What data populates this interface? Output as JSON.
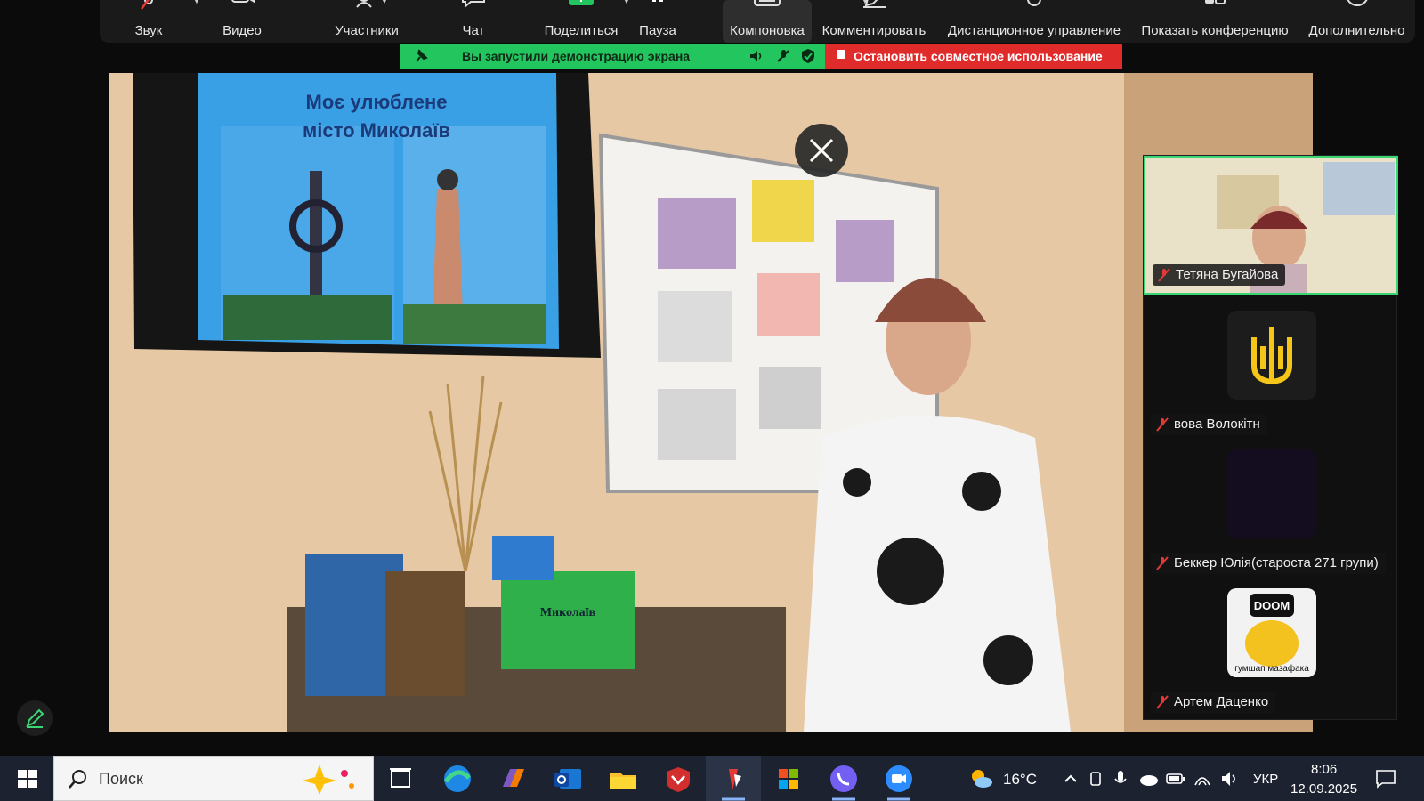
{
  "toolbar": {
    "items": [
      {
        "label": "Звук"
      },
      {
        "label": "Видео"
      },
      {
        "label": "Участники"
      },
      {
        "label": "Чат"
      },
      {
        "label": "Поделиться"
      },
      {
        "label": "Пауза"
      },
      {
        "label": "Компоновка"
      },
      {
        "label": "Комментировать"
      },
      {
        "label": "Дистанционное управление"
      },
      {
        "label": "Показать конференцию"
      },
      {
        "label": "Дополнительно"
      }
    ]
  },
  "share_banner": {
    "message": "Вы запустили демонстрацию экрана",
    "stop_label": "Остановить совместное использование"
  },
  "main_video": {
    "slide_title_line1": "Моє улюблене",
    "slide_title_line2": "місто Миколаїв",
    "book_title": "Миколаїв"
  },
  "participants": [
    {
      "name": "Тетяна Бугайова",
      "speaking": true
    },
    {
      "name": "вова Волокітн"
    },
    {
      "name": "Беккер Юлія(староста 271 групи)"
    },
    {
      "name": "Артем Даценко",
      "avatar_text_top": "DOOM",
      "avatar_text_bottom": "гумшап мазафака"
    }
  ],
  "taskbar": {
    "search_placeholder": "Поиск",
    "weather": "16°C",
    "lang": "УКР",
    "time": "8:06",
    "date": "12.09.2025"
  },
  "colors": {
    "share_green": "#22c55e",
    "stop_red": "#e02b2b",
    "speaking_border": "#3ad673"
  }
}
